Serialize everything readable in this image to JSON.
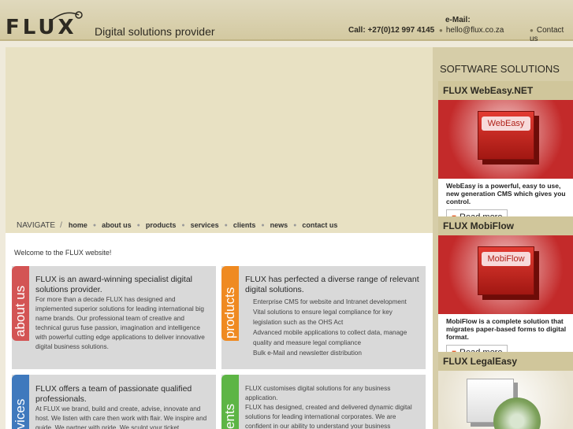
{
  "header": {
    "logo": "FLUX",
    "tagline": "Digital solutions provider",
    "call": "Call: +27(0)12 997 4145",
    "email_label": "e-Mail:",
    "email": "hello@flux.co.za",
    "contact": "Contact us"
  },
  "nav": {
    "label": "NAVIGATE",
    "separator": "/",
    "items": [
      "home",
      "about us",
      "products",
      "services",
      "clients",
      "news",
      "contact us"
    ]
  },
  "welcome": "Welcome to the FLUX website!",
  "cards": {
    "about": {
      "tab": "about us",
      "title": "FLUX is an award-winning specialist digital solutions provider.",
      "text": "For more than a decade FLUX has designed and implemented superior solutions for leading international big name brands. Our professional team of creative and technical gurus fuse passion, imagination and intelligence with powerful cutting edge applications to deliver innovative digital business solutions."
    },
    "products": {
      "tab": "products",
      "title": "FLUX has perfected a diverse range of relevant digital solutions.",
      "items": [
        "Enterprise CMS for website and Intranet development",
        "Vital solutions to ensure legal compliance for key legislation such as the OHS Act",
        "Advanced mobile applications to collect data, manage quality and measure legal compliance",
        "Bulk e-Mail and newsletter distribution"
      ]
    },
    "services": {
      "tab": "services",
      "title": "FLUX offers a team of passionate qualified professionals.",
      "text": "At FLUX we brand, build and create, advise, innovate and host. We listen with care then work with flair. We inspire and guide. We partner with pride. We sculpt your ticket"
    },
    "clients": {
      "tab": "clients",
      "title": "FLUX customises digital solutions for any business application.",
      "text": "FLUX has designed, created and delivered dynamic digital solutions for leading international corporates. We are confident in our ability to understand your business"
    }
  },
  "sidebar": {
    "title": "SOFTWARE SOLUTIONS",
    "products": [
      {
        "name": "FLUX WebEasy.NET",
        "box_label": "WebEasy",
        "desc": "WebEasy is a powerful, easy to use, new generation CMS which gives you control.",
        "button": "Read more"
      },
      {
        "name": "FLUX MobiFlow",
        "box_label": "MobiFlow",
        "desc": "MobiFlow is a complete solution that migrates paper-based forms to digital format.",
        "button": "Read more"
      },
      {
        "name": "FLUX LegalEasy"
      }
    ]
  }
}
